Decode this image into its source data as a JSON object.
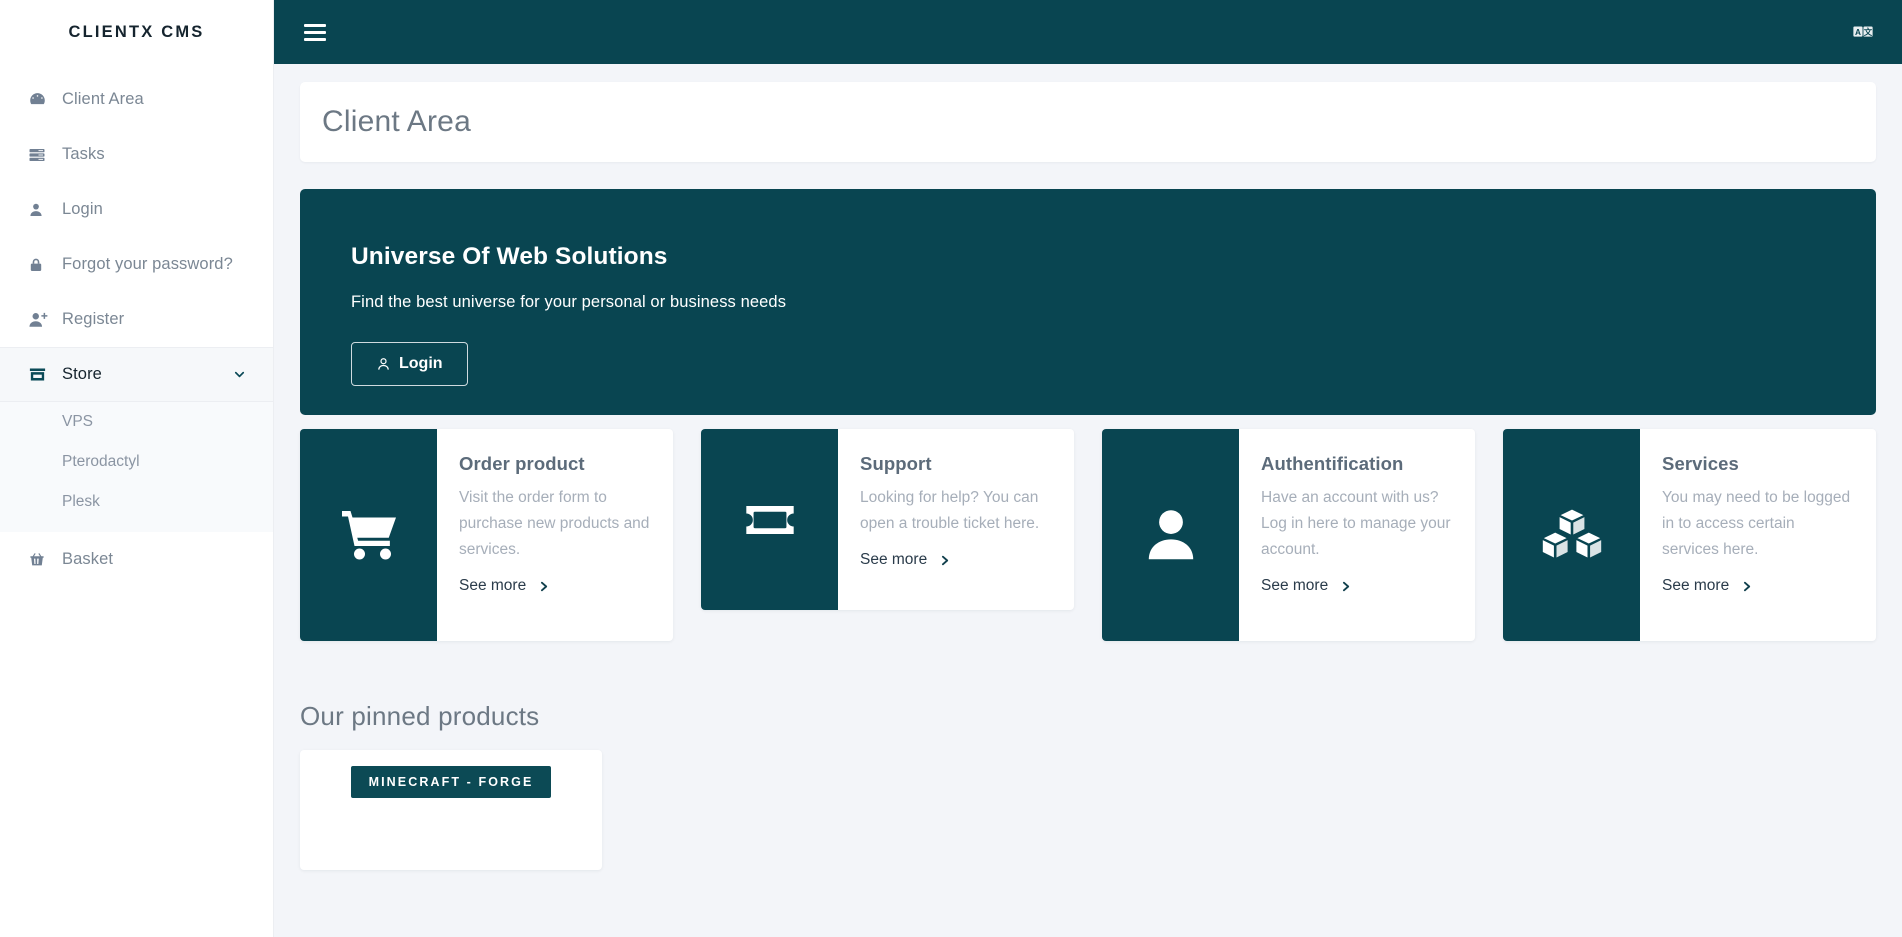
{
  "sidebar": {
    "brand": "CLIENTX CMS",
    "items": [
      {
        "label": "Client Area",
        "icon": "dashboard-icon",
        "active": false
      },
      {
        "label": "Tasks",
        "icon": "server-icon",
        "active": false
      },
      {
        "label": "Login",
        "icon": "user-icon",
        "active": false
      },
      {
        "label": "Forgot your password?",
        "icon": "lock-icon",
        "active": false
      },
      {
        "label": "Register",
        "icon": "user-plus-icon",
        "active": false
      },
      {
        "label": "Store",
        "icon": "store-icon",
        "active": true
      },
      {
        "label": "Basket",
        "icon": "basket-icon",
        "active": false
      }
    ],
    "store_children": [
      {
        "label": "VPS"
      },
      {
        "label": "Pterodactyl"
      },
      {
        "label": "Plesk"
      }
    ]
  },
  "topbar": {
    "menu_toggle": "hamburger-icon",
    "language_toggle": "translate-icon"
  },
  "page": {
    "title": "Client Area"
  },
  "hero": {
    "heading": "Universe Of Web Solutions",
    "subheading": "Find the best universe for your personal or business needs",
    "button_label": "Login",
    "button_icon": "user-icon"
  },
  "cards": [
    {
      "title": "Order product",
      "text": "Visit the order form to purchase new products and services.",
      "link": "See more",
      "icon": "shopping-cart-icon",
      "size": "tall"
    },
    {
      "title": "Support",
      "text": "Looking for help? You can open a trouble ticket here.",
      "link": "See more",
      "icon": "ticket-icon",
      "size": "short"
    },
    {
      "title": "Authentification",
      "text": "Have an account with us? Log in here to manage your account.",
      "link": "See more",
      "icon": "user-solid-icon",
      "size": "tall"
    },
    {
      "title": "Services",
      "text": "You may need to be logged in to access certain services here.",
      "link": "See more",
      "icon": "cubes-icon",
      "size": "tall"
    }
  ],
  "pinned": {
    "heading": "Our pinned products",
    "products": [
      {
        "badge": "MINECRAFT - FORGE"
      }
    ]
  },
  "colors": {
    "brand_teal": "#094551",
    "page_background": "#f3f5f9",
    "card_background": "#ffffff",
    "muted_text": "#a6aeb9",
    "heading_text": "#6c7884"
  }
}
